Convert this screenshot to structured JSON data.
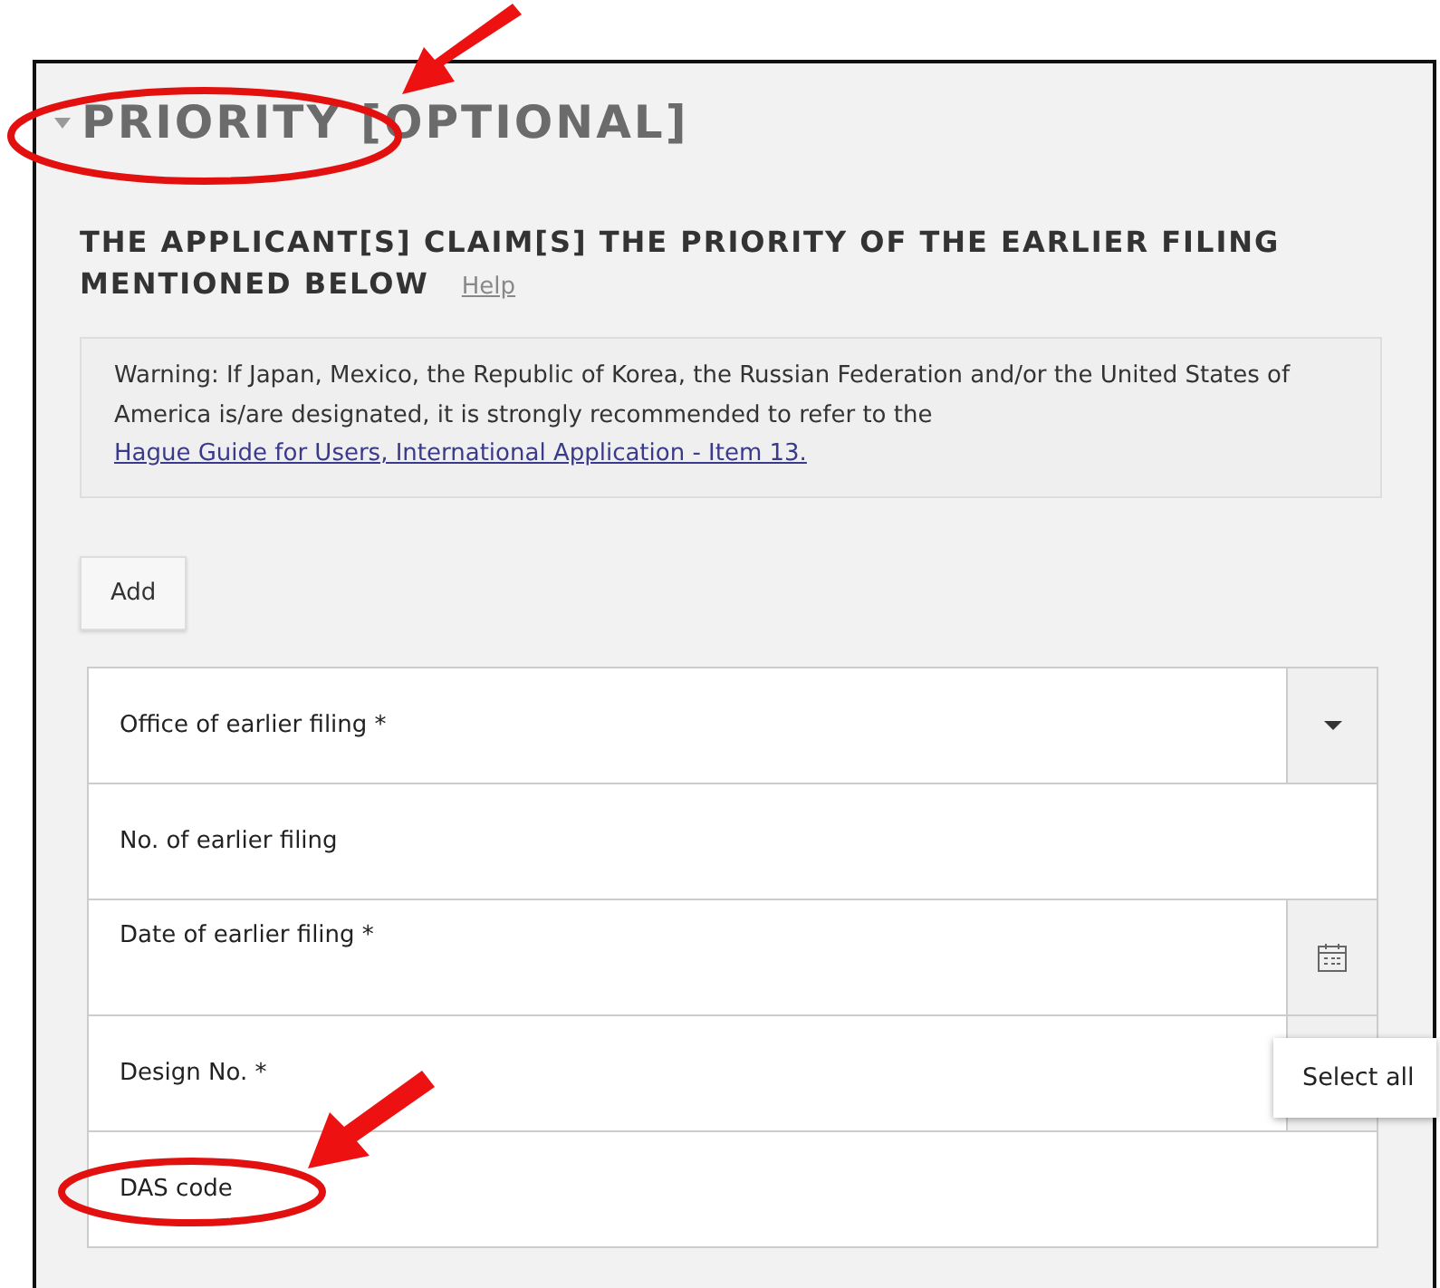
{
  "section": {
    "title": "PRIORITY [OPTIONAL]",
    "expanded": true
  },
  "claim": {
    "heading": "THE APPLICANT[S] CLAIM[S] THE PRIORITY OF THE EARLIER FILING MENTIONED BELOW",
    "help": "Help"
  },
  "warning": {
    "text": "Warning: If Japan, Mexico, the Republic of Korea, the Russian Federation and/or the United States of America is/are designated, it is strongly recommended to refer to the ",
    "link": "Hague Guide for Users, International Application - Item 13."
  },
  "add_button": "Add",
  "fields": [
    {
      "kind": "select",
      "label": "Office of earlier filing *"
    },
    {
      "kind": "text",
      "label": "No. of earlier filing"
    },
    {
      "kind": "date",
      "label": "Date of earlier filing *"
    },
    {
      "kind": "multiselect",
      "label": "Design No. *"
    },
    {
      "kind": "text",
      "label": "DAS code"
    }
  ],
  "menu": {
    "items": [
      "Select all"
    ]
  }
}
